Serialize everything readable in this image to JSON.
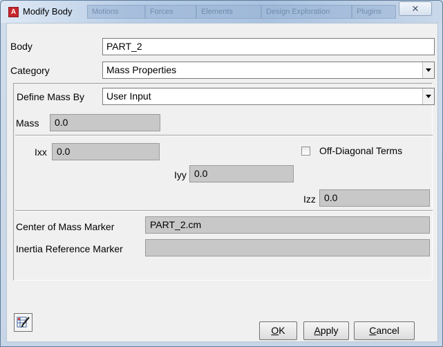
{
  "window": {
    "title": "Modify Body",
    "app_icon_letter": "A",
    "background_tabs": [
      "Motions",
      "Forces",
      "Elements",
      "Design Exploration",
      "Plugins"
    ],
    "close_glyph": "✕"
  },
  "form": {
    "body_label": "Body",
    "body_value": "PART_2",
    "category_label": "Category",
    "category_value": "Mass Properties",
    "define_mass_by_label": "Define Mass By",
    "define_mass_by_value": "User Input"
  },
  "mass": {
    "mass_label": "Mass",
    "mass_value": "0.0",
    "ixx_label": "Ixx",
    "ixx_value": "0.0",
    "iyy_label": "Iyy",
    "iyy_value": "0.0",
    "izz_label": "Izz",
    "izz_value": "0.0",
    "off_diagonal_label": "Off-Diagonal Terms",
    "off_diagonal_checked": false,
    "center_of_mass_label": "Center of Mass Marker",
    "center_of_mass_value": "PART_2.cm",
    "inertia_ref_label": "Inertia Reference Marker",
    "inertia_ref_value": ""
  },
  "buttons": {
    "ok_mnemonic": "O",
    "ok_rest": "K",
    "apply_mnemonic": "A",
    "apply_rest": "pply",
    "cancel_mnemonic": "C",
    "cancel_rest": "ancel"
  },
  "icons": {
    "app": "app-icon",
    "close": "close-icon",
    "dropdown": "chevron-down-icon",
    "table_edit": "table-edit-icon"
  },
  "colors": {
    "app_icon": "#c8262c",
    "dialog_bg": "#f0f0f0",
    "readonly_field": "#c8c8c8",
    "titlebar_tint": "#a9c2e0"
  }
}
